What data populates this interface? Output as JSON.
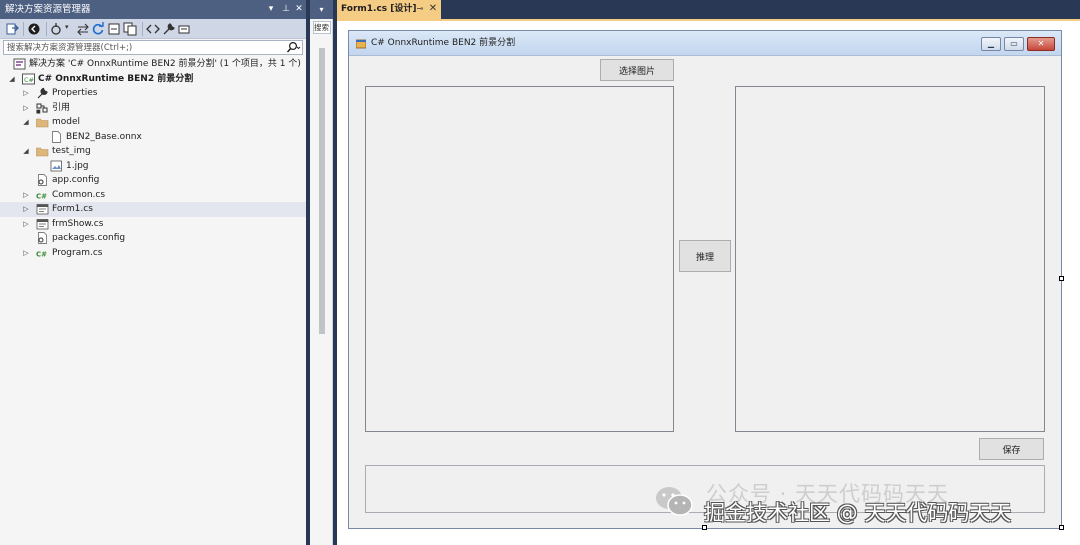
{
  "solution_explorer": {
    "title": "解决方案资源管理器",
    "search_placeholder": "搜索解决方案资源管理器(Ctrl+;)",
    "tree": [
      {
        "label": "解决方案 'C# OnnxRuntime BEN2 前景分割' (1 个项目，共 1 个)",
        "icon": "solution-icon",
        "expander": "none",
        "indent": 0
      },
      {
        "label": "C# OnnxRuntime BEN2 前景分割",
        "icon": "csharp-project-icon",
        "expander": "expanded",
        "indent": 1,
        "bold": true
      },
      {
        "label": "Properties",
        "icon": "wrench-icon",
        "expander": "collapsed",
        "indent": 2
      },
      {
        "label": "引用",
        "icon": "references-icon",
        "expander": "collapsed",
        "indent": 2
      },
      {
        "label": "model",
        "icon": "folder-icon",
        "expander": "expanded",
        "indent": 2
      },
      {
        "label": "BEN2_Base.onnx",
        "icon": "file-icon",
        "expander": "none",
        "indent": 3
      },
      {
        "label": "test_img",
        "icon": "folder-icon",
        "expander": "expanded",
        "indent": 2
      },
      {
        "label": "1.jpg",
        "icon": "image-file-icon",
        "expander": "none",
        "indent": 3
      },
      {
        "label": "app.config",
        "icon": "config-file-icon",
        "expander": "none",
        "indent": 2
      },
      {
        "label": "Common.cs",
        "icon": "csharp-file-icon",
        "expander": "collapsed",
        "indent": 2
      },
      {
        "label": "Form1.cs",
        "icon": "form-file-icon",
        "expander": "collapsed",
        "indent": 2,
        "selected": true
      },
      {
        "label": "frmShow.cs",
        "icon": "form-file-icon",
        "expander": "collapsed",
        "indent": 2
      },
      {
        "label": "packages.config",
        "icon": "config-file-icon",
        "expander": "none",
        "indent": 2
      },
      {
        "label": "Program.cs",
        "icon": "csharp-file-icon",
        "expander": "collapsed",
        "indent": 2
      }
    ]
  },
  "toolbox_strip": {
    "search_label": "搜索"
  },
  "document_tab": {
    "label": "Form1.cs [设计]"
  },
  "form": {
    "title": "C# OnnxRuntime BEN2 前景分割",
    "select_image_button": "选择图片",
    "infer_button": "推理",
    "save_button": "保存"
  },
  "watermark": {
    "line1": "公众号 · 天天代码码天天",
    "line2": "掘金技术社区 @ 天天代码码天天"
  },
  "colors": {
    "ide_frame": "#293955",
    "panel_title": "#4d6082",
    "active_tab": "#f5cc84",
    "form_background": "#f0f0f0"
  }
}
